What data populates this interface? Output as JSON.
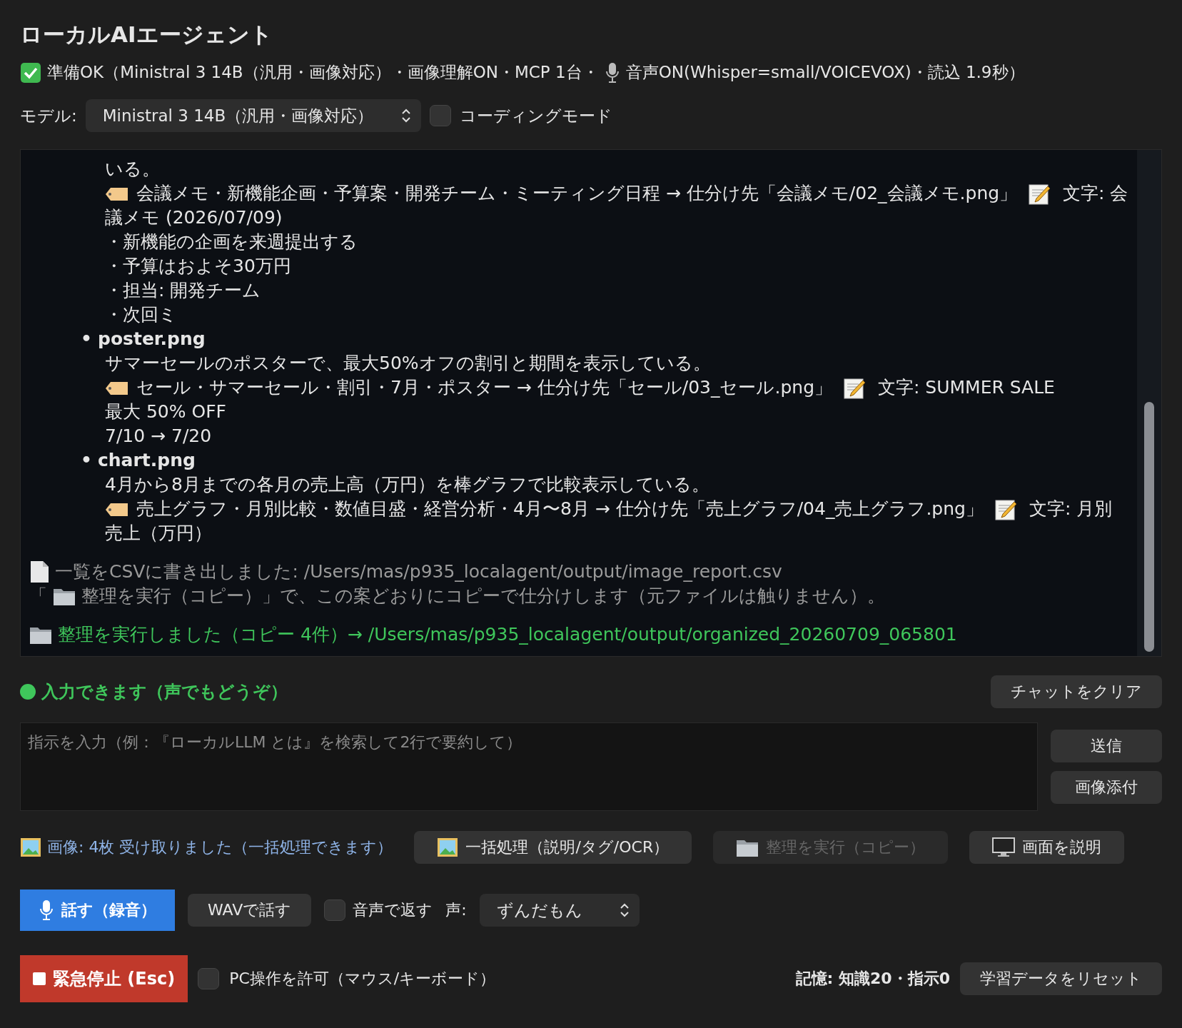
{
  "title": "ローカルAIエージェント",
  "status": {
    "text": "準備OK（Ministral 3 14B（汎用・画像対応）・画像理解ON・MCP 1台・",
    "voice_text": "音声ON(Whisper=small/VOICEVOX)・読込 1.9秒）"
  },
  "model": {
    "label": "モデル:",
    "value": "Ministral 3 14B（汎用・画像対応）",
    "coding_mode": {
      "label": "コーディングモード",
      "checked": false
    }
  },
  "chat": [
    {
      "kind": "text",
      "text": "いる。"
    },
    {
      "kind": "tags",
      "text": "会議メモ・新機能企画・予算案・開発チーム・ミーティング日程 → 仕分け先「会議メモ/02_会議メモ.png」",
      "ocr": "文字: 会"
    },
    {
      "kind": "text",
      "text": "議メモ (2026/07/09)"
    },
    {
      "kind": "text",
      "text": "・新機能の企画を来週提出する"
    },
    {
      "kind": "text",
      "text": "・予算はおよそ30万円"
    },
    {
      "kind": "text",
      "text": "・担当: 開発チーム"
    },
    {
      "kind": "text",
      "text": "・次回ミ"
    },
    {
      "kind": "file",
      "bullet": "•",
      "text": "poster.png"
    },
    {
      "kind": "text",
      "text": "サマーセールのポスターで、最大50%オフの割引と期間を表示している。"
    },
    {
      "kind": "tags",
      "text": "セール・サマーセール・割引・7月・ポスター → 仕分け先「セール/03_セール.png」",
      "ocr": "文字: SUMMER SALE"
    },
    {
      "kind": "text",
      "text": "最大 50% OFF"
    },
    {
      "kind": "text",
      "text": "7/10 → 7/20"
    },
    {
      "kind": "file",
      "bullet": "•",
      "text": "chart.png"
    },
    {
      "kind": "text",
      "text": "4月から8月までの各月の売上高（万円）を棒グラフで比較表示している。"
    },
    {
      "kind": "tags",
      "text": "売上グラフ・月別比較・数値目盛・経営分析・4月〜8月 → 仕分け先「売上グラフ/04_売上グラフ.png」",
      "ocr": "文字: 月別"
    },
    {
      "kind": "text",
      "text": "売上（万円）"
    },
    {
      "kind": "export",
      "text": "一覧をCSVに書き出しました: /Users/mas/p935_localagent/output/image_report.csv"
    },
    {
      "kind": "hint",
      "before": "「",
      "text": "整理を実行（コピー）」で、この案どおりにコピーで仕分けします（元ファイルは触りません）。"
    },
    {
      "kind": "done",
      "text": "整理を実行しました（コピー 4件）→ /Users/mas/p935_localagent/output/organized_20260709_065801"
    }
  ],
  "ready": "入力できます（声でもどうぞ）",
  "clear_button": "チャットをクリア",
  "input": {
    "placeholder": "指示を入力（例：『ローカルLLM とは』を検索して2行で要約して）"
  },
  "send_button": "送信",
  "attach_button": "画像添付",
  "images_note": "画像: 4枚 受け取りました（一括処理できます）",
  "batch_button": {
    "label": "一括処理（説明/タグ/OCR）",
    "disabled": false
  },
  "organize_button": {
    "label": "整理を実行（コピー）",
    "disabled": true
  },
  "describe_button": {
    "label": "画面を説明",
    "disabled": false
  },
  "talk_button": "話す（録音）",
  "wav_button": "WAVで話す",
  "voice_reply": {
    "label": "音声で返す",
    "checked": false
  },
  "voice": {
    "label": "声:",
    "value": "ずんだもん"
  },
  "stop_button": "緊急停止 (Esc)",
  "pc_control": {
    "label": "PC操作を許可（マウス/キーボード）",
    "checked": false
  },
  "memory": "記憶: 知識20・指示0",
  "reset_button": "学習データをリセット"
}
